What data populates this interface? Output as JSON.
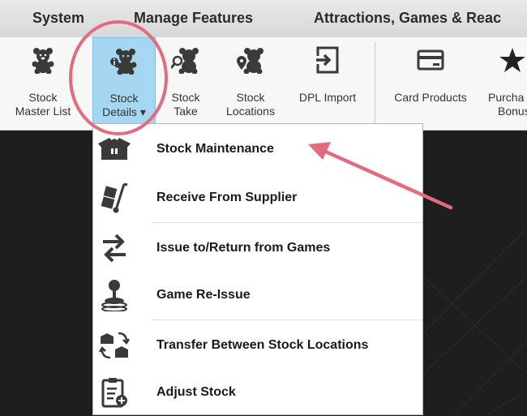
{
  "menubar": {
    "tabs": [
      "System",
      "Manage Features",
      "Attractions, Games & Reac"
    ]
  },
  "ribbon": {
    "buttons": [
      {
        "line1": "Stock",
        "line2": "Master List",
        "icon": "teddy-bear-icon"
      },
      {
        "line1": "Stock",
        "line2": "Details ▾",
        "icon": "teddy-bear-info-icon",
        "selected": true
      },
      {
        "line1": "Stock",
        "line2": "Take",
        "icon": "teddy-bear-search-icon"
      },
      {
        "line1": "Stock",
        "line2": "Locations",
        "icon": "teddy-bear-location-icon"
      },
      {
        "line1": "DPL Import",
        "line2": "",
        "icon": "import-icon"
      },
      {
        "line1": "Card Products",
        "line2": "",
        "icon": "card-icon"
      },
      {
        "line1": "Purcha",
        "line2": "Bonus",
        "icon": "star-icon"
      }
    ]
  },
  "dropdown": {
    "items": [
      {
        "label": "Stock Maintenance",
        "icon": "box-icon"
      },
      {
        "label": "Receive From Supplier",
        "icon": "hand-truck-icon"
      },
      {
        "label": "Issue to/Return from Games",
        "icon": "swap-arrows-icon"
      },
      {
        "label": "Game Re-Issue",
        "icon": "joystick-icon"
      },
      {
        "label": "Transfer Between Stock Locations",
        "icon": "transfer-boxes-icon"
      },
      {
        "label": "Adjust Stock",
        "icon": "clipboard-adjust-icon"
      }
    ]
  },
  "colors": {
    "highlight": "#a5d7f2",
    "callout": "#e26b80",
    "background": "#1e1e1e"
  }
}
